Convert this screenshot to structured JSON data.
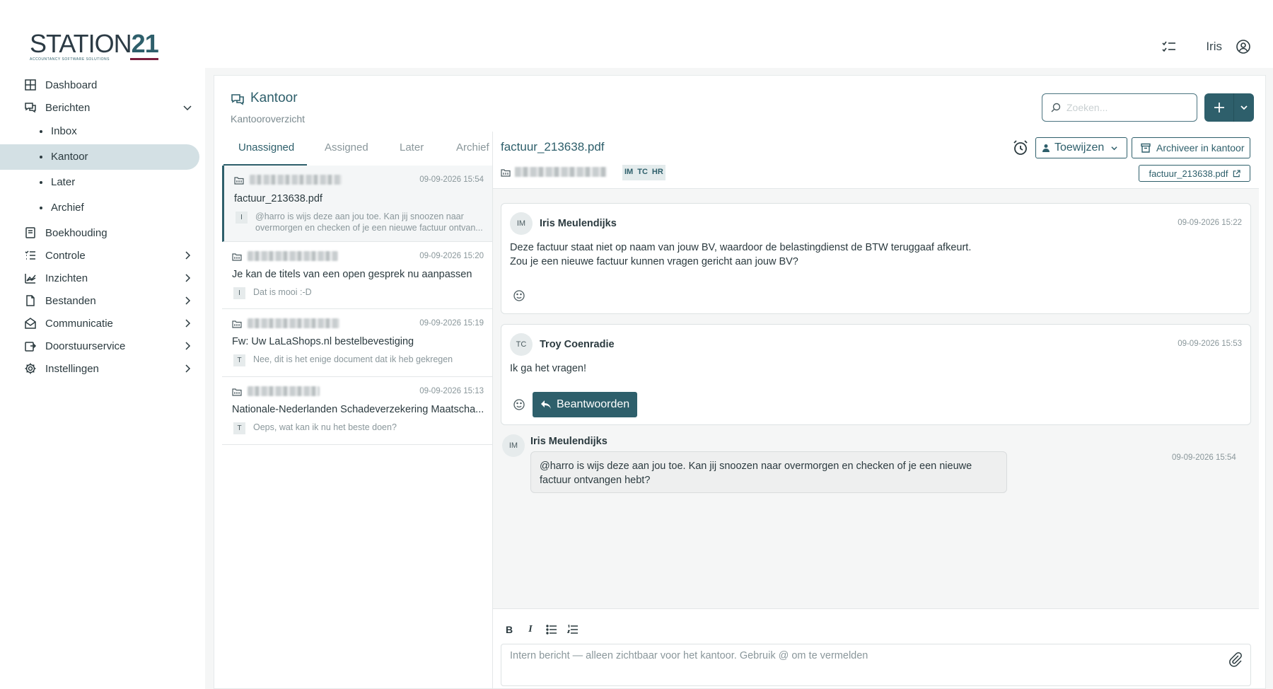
{
  "app": {
    "logo_text": "STATION",
    "logo_number": "21",
    "logo_tagline": "ACCOUNTANCY SOFTWARE SOLUTIONS",
    "user_name": "Iris"
  },
  "sidebar": {
    "items": [
      {
        "label": "Dashboard",
        "icon": "grid-icon"
      },
      {
        "label": "Berichten",
        "icon": "chat-icon"
      },
      {
        "label": "Boekhouding",
        "icon": "ledger-icon"
      },
      {
        "label": "Controle",
        "icon": "checklist-icon"
      },
      {
        "label": "Inzichten",
        "icon": "chart-icon"
      },
      {
        "label": "Bestanden",
        "icon": "file-icon"
      },
      {
        "label": "Communicatie",
        "icon": "envelope-icon"
      },
      {
        "label": "Doorstuurservice",
        "icon": "forward-icon"
      },
      {
        "label": "Instellingen",
        "icon": "gear-icon"
      }
    ],
    "sub_items": [
      {
        "label": "Inbox"
      },
      {
        "label": "Kantoor"
      },
      {
        "label": "Later"
      },
      {
        "label": "Archief"
      }
    ]
  },
  "page": {
    "title": "Kantoor",
    "subtitle": "Kantooroverzicht",
    "search_placeholder": "Zoeken..."
  },
  "tabs": [
    {
      "label": "Unassigned"
    },
    {
      "label": "Assigned"
    },
    {
      "label": "Later"
    },
    {
      "label": "Archief"
    }
  ],
  "conversations": [
    {
      "time": "09-09-2026 15:54",
      "subject": "factuur_213638.pdf",
      "badge": "I",
      "preview": "@harro is wijs deze aan jou toe. Kan jij snoozen naar overmorgen en checken of je een nieuwe factuur ontvan..."
    },
    {
      "time": "09-09-2026 15:20",
      "subject": "Je kan de titels van een open gesprek nu aanpassen",
      "badge": "I",
      "preview": "Dat is mooi :-D"
    },
    {
      "time": "09-09-2026 15:19",
      "subject": "Fw: Uw LaLaShops.nl bestelbevestiging",
      "badge": "T",
      "preview": "Nee, dit is het enige document dat ik heb gekregen"
    },
    {
      "time": "09-09-2026 15:13",
      "subject": "Nationale-Nederlanden Schadeverzekering Maatscha...",
      "badge": "T",
      "preview": "Oeps, wat kan ik nu het beste doen?"
    }
  ],
  "detail": {
    "title": "factuur_213638.pdf",
    "participants": [
      "IM",
      "TC",
      "HR"
    ],
    "assign_label": "Toewijzen",
    "archive_label": "Archiveer in kantoor",
    "file_label": "factuur_213638.pdf",
    "messages": [
      {
        "initials": "IM",
        "name": "Iris Meulendijks",
        "time": "09-09-2026 15:22",
        "line1": "Deze factuur staat niet op naam van jouw BV, waardoor de belastingdienst de BTW teruggaaf afkeurt.",
        "line2": "Zou je een nieuwe factuur kunnen vragen gericht aan jouw BV?"
      },
      {
        "initials": "TC",
        "name": "Troy Coenradie",
        "time": "09-09-2026 15:53",
        "line1": "Ik ga het vragen!",
        "reply_label": "Beantwoorden"
      }
    ],
    "note": {
      "initials": "IM",
      "name": "Iris Meulendijks",
      "time": "09-09-2026 15:54",
      "text": "@harro is wijs deze aan jou toe. Kan jij snoozen naar overmorgen en checken of je een nieuwe factuur ontvangen hebt?"
    },
    "composer_placeholder": "Intern bericht — alleen zichtbaar voor het kantoor. Gebruik @ om te vermelden"
  },
  "colors": {
    "accent": "#2e5f6b",
    "active_nav_bg": "#d3e0e4",
    "logo_bar": "#7a1f3d"
  }
}
